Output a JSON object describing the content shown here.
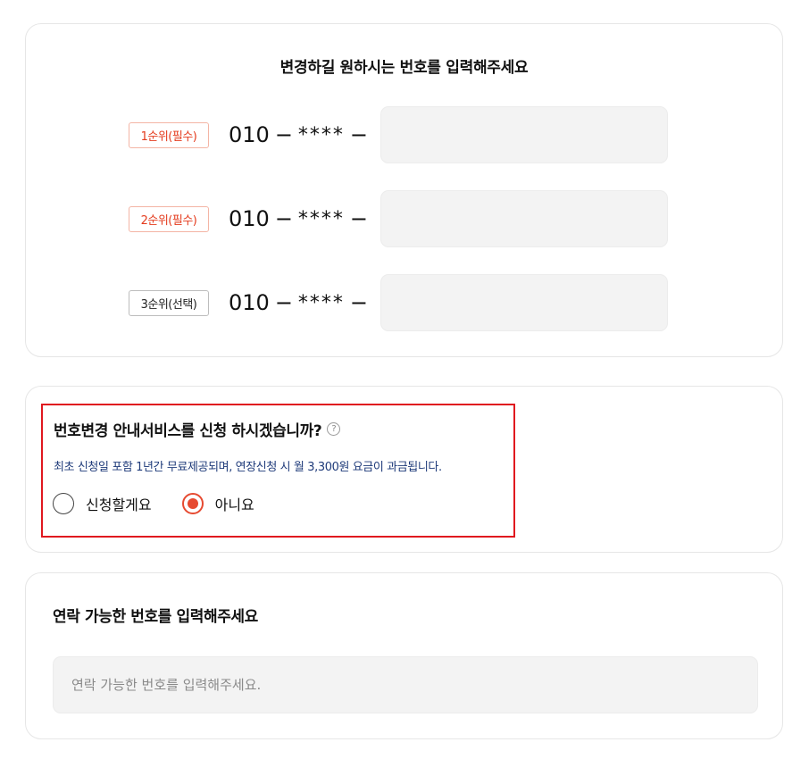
{
  "numbers_section": {
    "title": "변경하길 원하시는 번호를 입력해주세요",
    "rows": [
      {
        "badge": "1순위(필수)",
        "prefix": "010",
        "dash1": "−",
        "mask": "****",
        "dash2": "−",
        "value": ""
      },
      {
        "badge": "2순위(필수)",
        "prefix": "010",
        "dash1": "−",
        "mask": "****",
        "dash2": "−",
        "value": ""
      },
      {
        "badge": "3순위(선택)",
        "prefix": "010",
        "dash1": "−",
        "mask": "****",
        "dash2": "−",
        "value": ""
      }
    ]
  },
  "service_section": {
    "question": "번호변경 안내서비스를 신청 하시겠습니까?",
    "help_icon": "?",
    "note": "최초 신청일 포함 1년간 무료제공되며, 연장신청 시 월 3,300원 요금이 과금됩니다.",
    "options": [
      {
        "label": "신청할게요",
        "selected": false
      },
      {
        "label": "아니요",
        "selected": true
      }
    ],
    "accent_color": "#e64a31",
    "highlight_color": "#e0181f"
  },
  "contact_section": {
    "title": "연락 가능한 번호를 입력해주세요",
    "placeholder": "연락 가능한 번호를 입력해주세요.",
    "value": ""
  }
}
